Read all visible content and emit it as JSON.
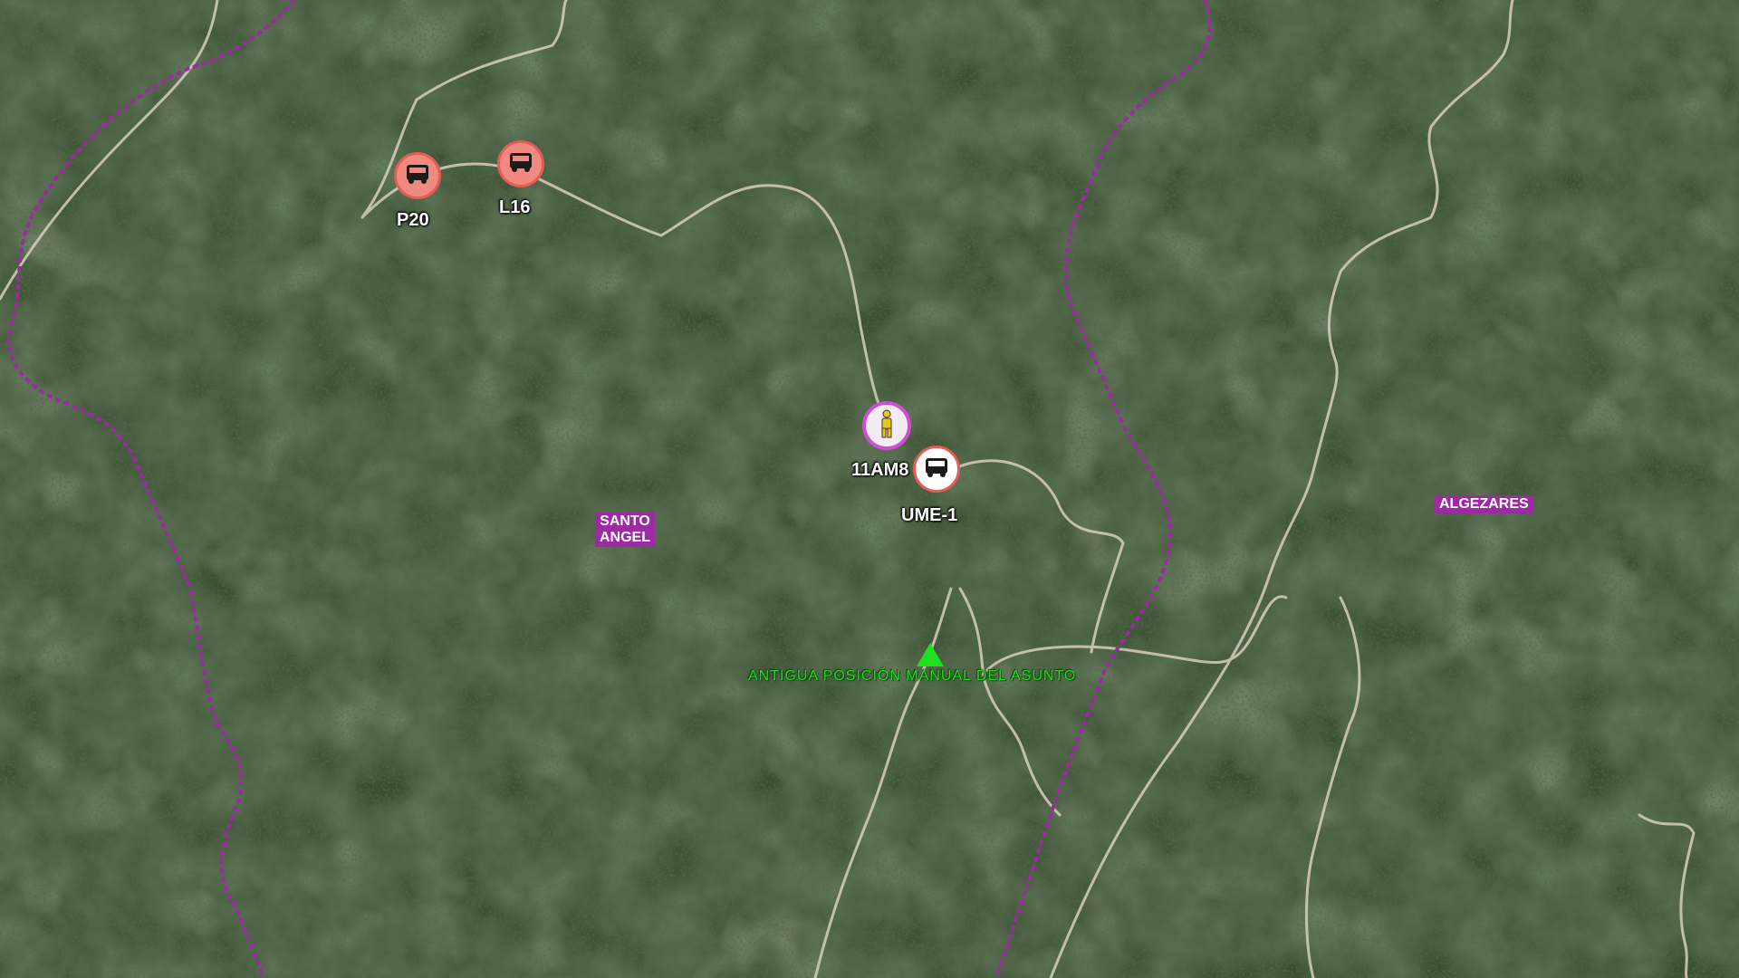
{
  "units": [
    {
      "id": "P20",
      "label": "P20",
      "type": "vehicle",
      "color": "#f08a80"
    },
    {
      "id": "L16",
      "label": "L16",
      "type": "vehicle",
      "color": "#f08a80"
    },
    {
      "id": "11AM8",
      "label": "11AM8",
      "type": "person",
      "color": "#cf4fd1"
    },
    {
      "id": "UME-1",
      "label": "UME-1",
      "type": "vehicle",
      "color": "#ffffff"
    }
  ],
  "places": {
    "santo_angel": "SANTO\nANGEL",
    "algezares": "ALGEZARES"
  },
  "incident": {
    "old_position_label": "ANTIGUA POSICIÓN MANUAL DEL ASUNTO"
  },
  "colors": {
    "boundary": "#9b2aa3",
    "old_position": "#1ee01e",
    "vehicle_ring": "#e35d55",
    "person_ring": "#cf4fd1"
  },
  "icons": {
    "vehicle": "truck-icon",
    "person": "person-icon",
    "old_position": "triangle-marker-icon"
  }
}
